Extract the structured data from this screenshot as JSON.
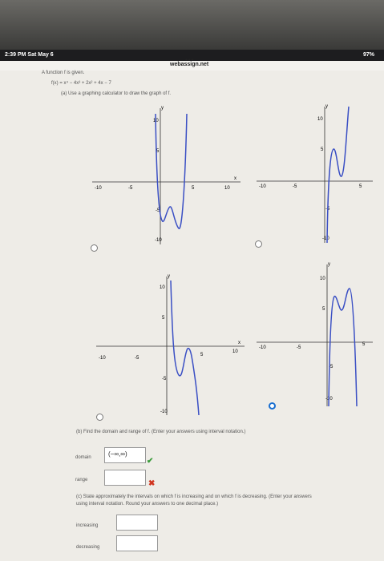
{
  "status": {
    "time": "2:39 PM  Sat May 6",
    "battery": "97%"
  },
  "browser": {
    "url": "webassign.net",
    "dots": "•••"
  },
  "question": {
    "intro": "A function f is given.",
    "function": "f(x) = x⁴ − 4x³ + 2x² + 4x − 7",
    "part_a": "(a) Use a graphing calculator to draw the graph of f.",
    "part_b": "(b) Find the domain and range of f. (Enter your answers using interval notation.)",
    "part_c_1": "(c) State approximately the intervals on which f is increasing and on which f is decreasing. (Enter your answers",
    "part_c_2": "using interval notation. Round your answers to one decimal place.)"
  },
  "graph_labels": {
    "y": "y",
    "x": "x",
    "t_p10": "10",
    "t_p5": "5",
    "t_m5": "-5",
    "t_m10": "-10",
    "x_m10": "-10",
    "x_m5": "-5",
    "x_p5": "5",
    "x_p10": "10"
  },
  "fields": {
    "domain_label": "domain",
    "domain_value": "(−∞,∞)",
    "range_label": "range",
    "range_value": "",
    "increasing_label": "increasing",
    "decreasing_label": "decreasing"
  },
  "marks": {
    "correct": "✔",
    "incorrect": "✖"
  },
  "options": [
    {
      "id": "A",
      "selected": false
    },
    {
      "id": "B",
      "selected": false
    },
    {
      "id": "C",
      "selected": false
    },
    {
      "id": "D",
      "selected": true
    }
  ]
}
